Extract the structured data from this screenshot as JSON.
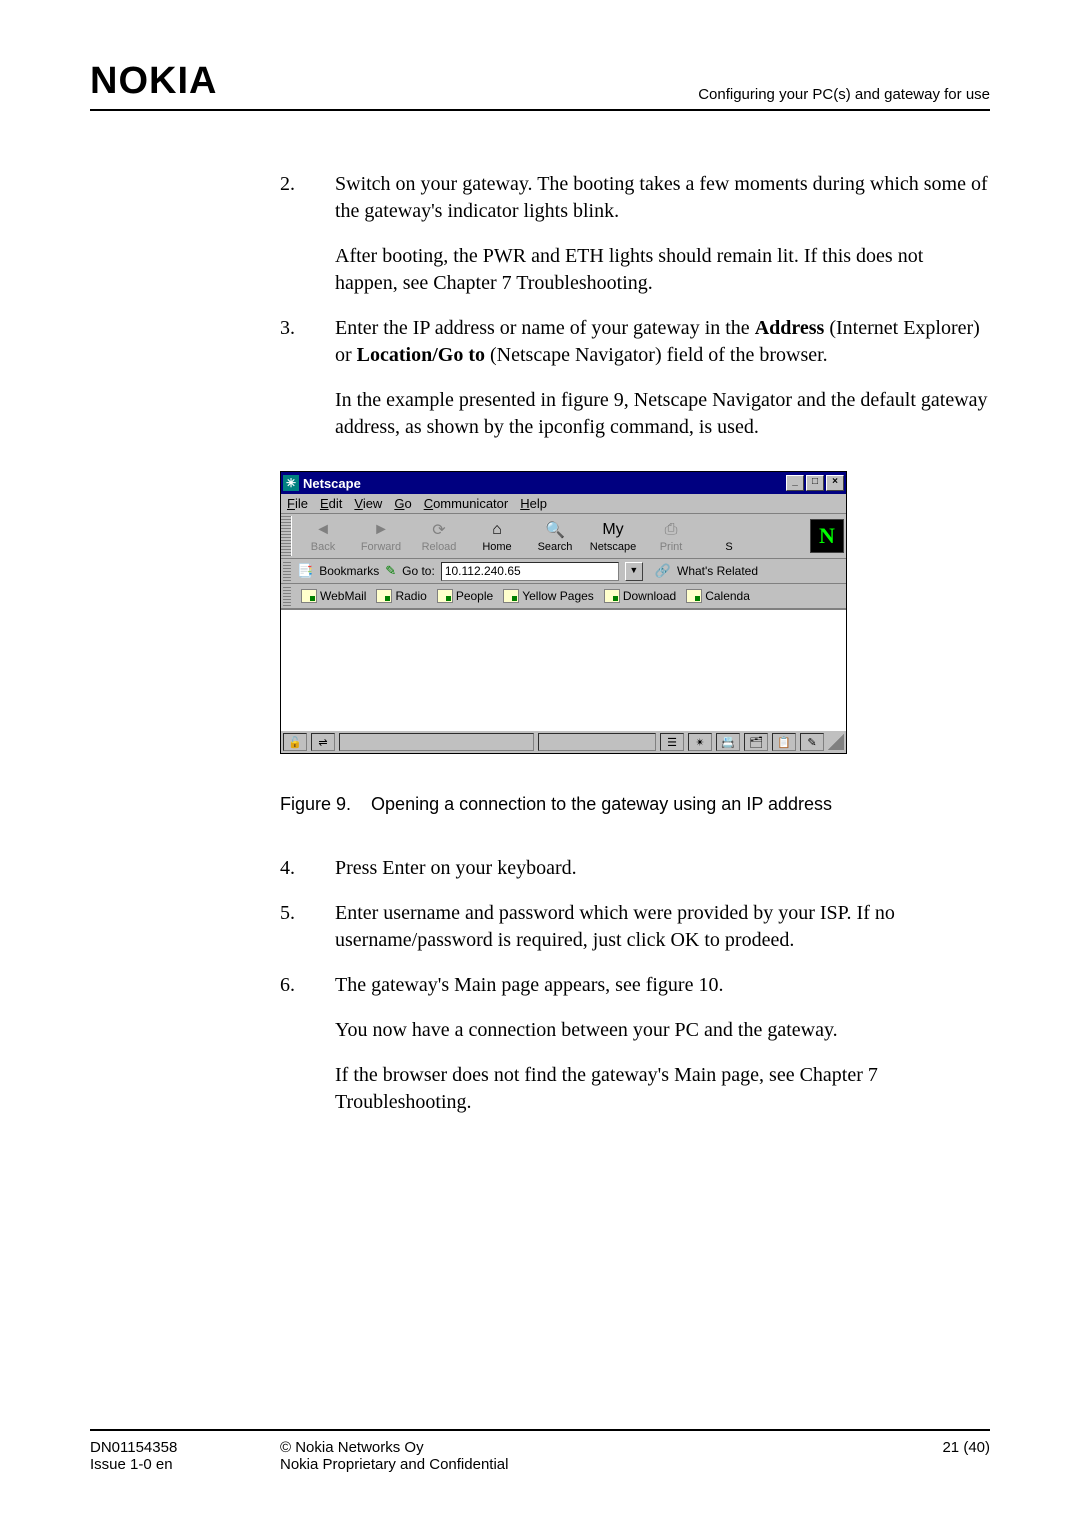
{
  "header": {
    "logo": "NOKIA",
    "section": "Configuring your PC(s) and gateway for use"
  },
  "steps_a": [
    {
      "num": "2.",
      "paras": [
        "Switch on your gateway. The booting takes a few moments during which some of the gateway's indicator lights blink.",
        "After booting, the PWR and ETH lights should remain lit. If this does not happen, see Chapter 7 Troubleshooting."
      ]
    },
    {
      "num": "3.",
      "paras": [
        "Enter the IP address or name of your gateway in the <b>Address</b> (Internet Explorer) or <b>Location/Go to</b> (Netscape Navigator) field of the browser.",
        "In the example presented in figure 9, Netscape Navigator and the default gateway address, as shown by the ipconfig command, is used."
      ]
    }
  ],
  "netscape": {
    "title": "Netscape",
    "menus": [
      "File",
      "Edit",
      "View",
      "Go",
      "Communicator",
      "Help"
    ],
    "tools": [
      {
        "label": "Back",
        "active": false,
        "icon": "◄"
      },
      {
        "label": "Forward",
        "active": false,
        "icon": "►"
      },
      {
        "label": "Reload",
        "active": false,
        "icon": "⟳"
      },
      {
        "label": "Home",
        "active": true,
        "icon": "⌂"
      },
      {
        "label": "Search",
        "active": true,
        "icon": "🔍"
      },
      {
        "label": "Netscape",
        "active": true,
        "icon": "My"
      },
      {
        "label": "Print",
        "active": false,
        "icon": "⎙"
      },
      {
        "label": "S",
        "active": true,
        "icon": ""
      }
    ],
    "throbber": "N",
    "bookmarks_label": "Bookmarks",
    "goto_label": "Go to:",
    "goto_value": "10.112.240.65",
    "related_label": "What's Related",
    "links": [
      "WebMail",
      "Radio",
      "People",
      "Yellow Pages",
      "Download",
      "Calenda"
    ],
    "win_buttons": [
      "_",
      "□",
      "×"
    ]
  },
  "figure": {
    "label": "Figure 9.",
    "caption": "Opening a connection to the gateway using an IP address"
  },
  "steps_b": [
    {
      "num": "4.",
      "paras": [
        "Press Enter on your keyboard."
      ]
    },
    {
      "num": "5.",
      "paras": [
        "Enter username and password which were provided by your ISP. If no username/password is required, just click OK to prodeed."
      ]
    },
    {
      "num": "6.",
      "paras": [
        "The gateway's Main page appears, see figure 10.",
        "You now have a connection between your PC and the gateway.",
        "If the browser does not find the gateway's Main page, see Chapter 7 Troubleshooting."
      ]
    }
  ],
  "footer": {
    "doc_id": "DN01154358",
    "issue": "Issue 1-0 en",
    "copyright": "© Nokia Networks Oy",
    "confidential": "Nokia Proprietary and Confidential",
    "page": "21 (40)"
  }
}
